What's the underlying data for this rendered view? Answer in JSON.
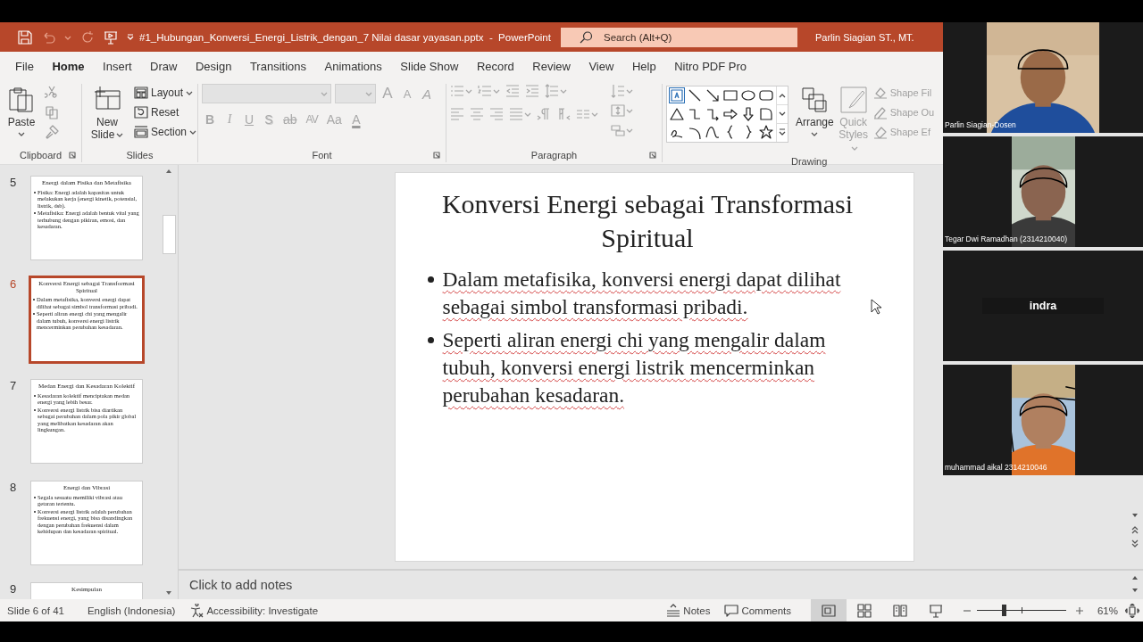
{
  "title_bar": {
    "document": "#1_Hubungan_Konversi_Energi_Listrik_dengan_7 Nilai dasar yayasan.pptx  -  PowerPoint",
    "search": {
      "placeholder": "Search (Alt+Q)"
    },
    "user": "Parlin Siagian ST., MT."
  },
  "tabs": [
    {
      "label": "File",
      "selected": false
    },
    {
      "label": "Home",
      "selected": true
    },
    {
      "label": "Insert",
      "selected": false
    },
    {
      "label": "Draw",
      "selected": false
    },
    {
      "label": "Design",
      "selected": false
    },
    {
      "label": "Transitions",
      "selected": false
    },
    {
      "label": "Animations",
      "selected": false
    },
    {
      "label": "Slide Show",
      "selected": false
    },
    {
      "label": "Record",
      "selected": false
    },
    {
      "label": "Review",
      "selected": false
    },
    {
      "label": "View",
      "selected": false
    },
    {
      "label": "Help",
      "selected": false
    },
    {
      "label": "Nitro PDF Pro",
      "selected": false
    }
  ],
  "ribbon": {
    "clipboard": {
      "label": "Clipboard",
      "paste": "Paste"
    },
    "slides": {
      "label": "Slides",
      "new_slide": "New Slide",
      "layout": "Layout",
      "reset": "Reset",
      "section": "Section"
    },
    "font": {
      "label": "Font",
      "disabled": true,
      "size_tools": [
        {
          "label": "A",
          "kind": "grow"
        },
        {
          "label": "A",
          "kind": "shrink"
        },
        {
          "label": "A",
          "kind": "clear"
        }
      ],
      "format_tools": [
        {
          "label": "B",
          "kind": "bold"
        },
        {
          "label": "I",
          "kind": "italic"
        },
        {
          "label": "U",
          "kind": "underline"
        },
        {
          "label": "S",
          "kind": "shadow"
        },
        {
          "label": "ab",
          "kind": "strike"
        },
        {
          "label": "AV",
          "kind": "spacing"
        },
        {
          "label": "Aa",
          "kind": "case"
        },
        {
          "label": "A",
          "kind": "color"
        }
      ]
    },
    "paragraph": {
      "label": "Paragraph",
      "disabled": true
    },
    "drawing": {
      "label": "Drawing",
      "arrange": "Arrange",
      "quick_styles": {
        "label": "Quick Styles",
        "disabled": true
      },
      "shape_tools": [
        {
          "label": "Shape Fil",
          "kind": "fill",
          "disabled": true
        },
        {
          "label": "Shape Ou",
          "kind": "outline",
          "disabled": true
        },
        {
          "label": "Shape Ef",
          "kind": "effects",
          "disabled": true
        }
      ]
    }
  },
  "thumbnails": [
    {
      "number": "5",
      "title": "Energi dalam Fisika dan Metafisika",
      "bullets": [
        "Fisika: Energi adalah kapasitas untuk melakukan kerja (energi kinetik, potensial, listrik, dsb).",
        "Metafisika: Energi adalah bentuk vital yang terhubung dengan pikiran, emosi, dan kesadaran."
      ],
      "selected": false
    },
    {
      "number": "6",
      "title": "Konversi Energi sebagai Transformasi Spiritual",
      "bullets": [
        "Dalam metafisika, konversi energi dapat dilihat sebagai simbol transformasi pribadi.",
        "Seperti aliran energi chi yang mengalir dalam tubuh, konversi energi listrik mencerminkan perubahan kesadaran."
      ],
      "selected": true
    },
    {
      "number": "7",
      "title": "Medan Energi dan Kesadaran Kolektif",
      "bullets": [
        "Kesadaran kolektif menciptakan medan energi yang lebih besar.",
        "Konversi energi listrik bisa diartikan sebagai perubahan dalam pola pikir global yang melibatkan kesadaran akan lingkungan."
      ],
      "selected": false
    },
    {
      "number": "8",
      "title": "Energi dan Vibrasi",
      "bullets": [
        "Segala sesuatu memiliki vibrasi atau getaran tertentu.",
        "Konversi energi listrik adalah perubahan frekuensi energi, yang bisa disandingkan dengan perubahan frekuensi dalam kehidupan dan kesadaran spiritual."
      ],
      "selected": false
    },
    {
      "number": "9",
      "title": "Kesimpulan",
      "selected": false
    }
  ],
  "slide": {
    "title": "Konversi Energi sebagai Transformasi Spiritual",
    "bullets": [
      "Dalam metafisika, konversi energi dapat dilihat sebagai simbol transformasi pribadi.",
      "Seperti aliran energi chi yang mengalir dalam tubuh, konversi energi listrik mencerminkan perubahan kesadaran."
    ]
  },
  "notes": {
    "placeholder": "Click to add notes"
  },
  "status_bar": {
    "slide_position": "Slide 6 of 41",
    "language": "English (Indonesia)",
    "accessibility": "Accessibility: Investigate",
    "notes": "Notes",
    "comments": "Comments",
    "views": [
      {
        "kind": "normal",
        "selected": true
      },
      {
        "kind": "sorter",
        "selected": false
      },
      {
        "kind": "reading",
        "selected": false
      },
      {
        "kind": "slideshow",
        "selected": false
      }
    ],
    "zoom": {
      "level": 0.3,
      "reading": "61%"
    }
  },
  "participants": [
    {
      "name": "Parlin Siagian-Dosen",
      "kind": "video"
    },
    {
      "name": "Tegar Dwi Ramadhan (2314210040)",
      "kind": "video"
    },
    {
      "name": "indra",
      "kind": "name_only"
    },
    {
      "name": "muhammad aikal 2314210046",
      "kind": "video"
    }
  ]
}
